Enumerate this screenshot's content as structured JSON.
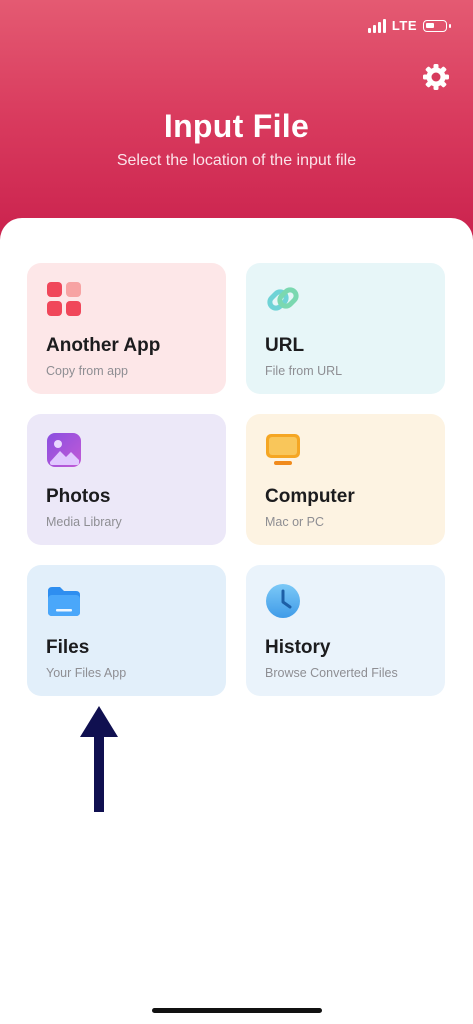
{
  "status_bar": {
    "network": "LTE"
  },
  "header": {
    "title": "Input File",
    "subtitle": "Select the location of the input file"
  },
  "options": [
    {
      "title": "Another App",
      "subtitle": "Copy from app",
      "icon": "apps-grid-icon"
    },
    {
      "title": "URL",
      "subtitle": "File from URL",
      "icon": "link-icon"
    },
    {
      "title": "Photos",
      "subtitle": "Media Library",
      "icon": "photo-icon"
    },
    {
      "title": "Computer",
      "subtitle": "Mac or PC",
      "icon": "monitor-icon"
    },
    {
      "title": "Files",
      "subtitle": "Your Files App",
      "icon": "folder-icon"
    },
    {
      "title": "History",
      "subtitle": "Browse Converted Files",
      "icon": "clock-icon"
    }
  ],
  "colors": {
    "header_top": "#e45a72",
    "header_bottom": "#c81e4b",
    "annotation_arrow": "#101050"
  }
}
